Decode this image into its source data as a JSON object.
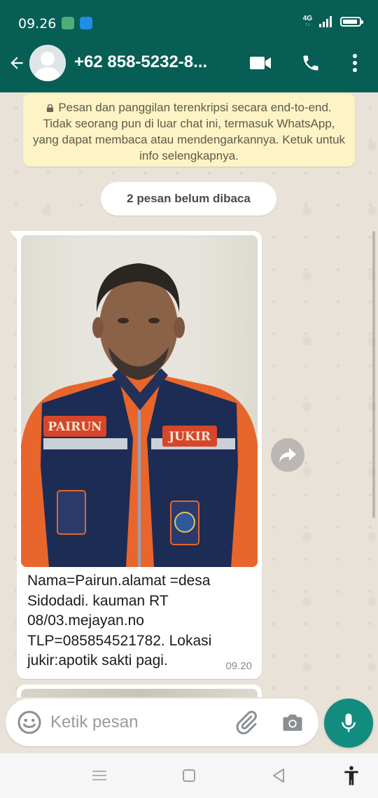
{
  "status_bar": {
    "time": "09.26",
    "network": "4G",
    "network_sub": "↑↓",
    "battery_level": 0.9
  },
  "header": {
    "contact_name": "+62 858-5232-8...",
    "icons": {
      "back": "back-arrow-icon",
      "avatar": "default-avatar-icon",
      "video_call": "video-camera-icon",
      "voice_call": "phone-icon",
      "menu": "more-vert-icon"
    }
  },
  "encryption_notice": {
    "text": "Pesan dan panggilan terenkripsi secara end-to-end. Tidak seorang pun di luar chat ini, termasuk WhatsApp, yang dapat membaca atau mendengarkannya. Ketuk untuk info selengkapnya."
  },
  "unread_divider": {
    "text": "2 pesan belum dibaca"
  },
  "messages": [
    {
      "type": "image",
      "photo_labels": {
        "chest_left": "PAIRUN",
        "chest_right": "JUKIR"
      },
      "caption": "Nama=Pairun.alamat =desa Sidodadi. kauman RT 08/03.mejayan.no TLP=085854521782. Lokasi jukir:apotik sakti pagi.",
      "time": "09.20"
    }
  ],
  "composer": {
    "placeholder": "Ketik pesan",
    "value": ""
  },
  "colors": {
    "header": "#075e54",
    "accent": "#128c7e",
    "chat_background": "#e9e2d8",
    "notice_background": "#fdf3c5"
  }
}
